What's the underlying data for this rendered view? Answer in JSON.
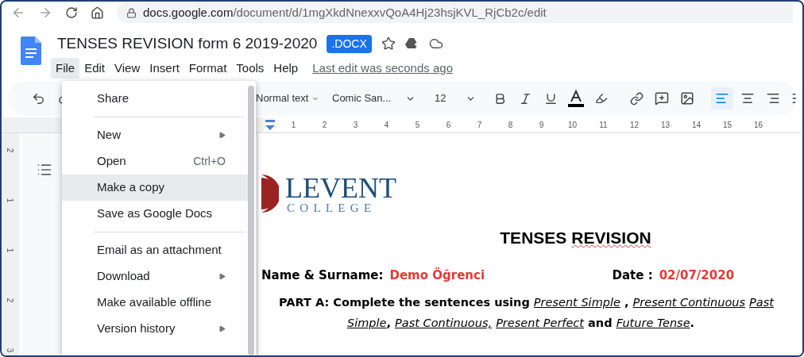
{
  "browser": {
    "url_host": "docs.google.com",
    "url_path": "/document/d/1mgXkdNnexxvQoA4Hj23hsjKVL_RjCb2c/edit"
  },
  "document": {
    "title": "TENSES REVISION form 6 2019-2020",
    "badge": ".DOCX",
    "last_edit": "Last edit was seconds ago"
  },
  "menu_bar": [
    {
      "label": "File",
      "selected": true
    },
    {
      "label": "Edit",
      "selected": false
    },
    {
      "label": "View",
      "selected": false
    },
    {
      "label": "Insert",
      "selected": false
    },
    {
      "label": "Format",
      "selected": false
    },
    {
      "label": "Tools",
      "selected": false
    },
    {
      "label": "Help",
      "selected": false
    }
  ],
  "toolbar": {
    "style": "Normal text",
    "font": "Comic San...",
    "size": "12",
    "alignments": [
      {
        "kind": "left",
        "selected": true
      },
      {
        "kind": "center",
        "selected": false
      },
      {
        "kind": "right",
        "selected": false
      },
      {
        "kind": "justify",
        "selected": false
      }
    ]
  },
  "ruler_numbers": [
    "1",
    "2",
    "3",
    "4",
    "5",
    "6",
    "7",
    "8",
    "9",
    "10",
    "11",
    "12",
    "13",
    "14",
    "15",
    "16"
  ],
  "vertical_ruler_numbers": [
    "2",
    "1",
    "1",
    "2",
    "3"
  ],
  "file_menu": [
    {
      "kind": "item",
      "label": "Share",
      "highlighted": false
    },
    {
      "kind": "divider"
    },
    {
      "kind": "item",
      "label": "New",
      "submenu": true,
      "highlighted": false
    },
    {
      "kind": "item",
      "label": "Open",
      "shortcut": "Ctrl+O",
      "highlighted": false
    },
    {
      "kind": "item",
      "label": "Make a copy",
      "highlighted": true
    },
    {
      "kind": "item",
      "label": "Save as Google Docs",
      "highlighted": false
    },
    {
      "kind": "divider"
    },
    {
      "kind": "item",
      "label": "Email as an attachment",
      "highlighted": false
    },
    {
      "kind": "item",
      "label": "Download",
      "submenu": true,
      "highlighted": false
    },
    {
      "kind": "item",
      "label": "Make available offline",
      "highlighted": false
    },
    {
      "kind": "item",
      "label": "Version history",
      "submenu": true,
      "highlighted": false
    }
  ],
  "page": {
    "logo_name": "LEVENT",
    "logo_sub": "COLLEGE",
    "heading": [
      {
        "text": "TENSES",
        "misspelled": false
      },
      {
        "text": "REVISION",
        "misspelled": true
      }
    ],
    "name_label": "Name & Surname:",
    "name_value": "Demo Öğrenci",
    "date_label": "Date :",
    "date_value": "02/07/2020",
    "part_a": [
      [
        {
          "kind": "bold",
          "text": "PART A: Complete the sentences using "
        },
        {
          "kind": "term",
          "text": "Present Simple"
        },
        {
          "kind": "bold",
          "text": " , "
        },
        {
          "kind": "term",
          "text": "Present Continuous"
        },
        {
          "kind": "term",
          "text": "Past"
        }
      ],
      [
        {
          "kind": "term",
          "text": "Simple"
        },
        {
          "kind": "bold",
          "text": ", "
        },
        {
          "kind": "term",
          "text": "Past Continuous,"
        },
        {
          "kind": "term",
          "text": "Present Perfect"
        },
        {
          "kind": "bold",
          "text": " and "
        },
        {
          "kind": "term",
          "text": "Future Tense"
        },
        {
          "kind": "bold",
          "text": "."
        }
      ]
    ]
  }
}
